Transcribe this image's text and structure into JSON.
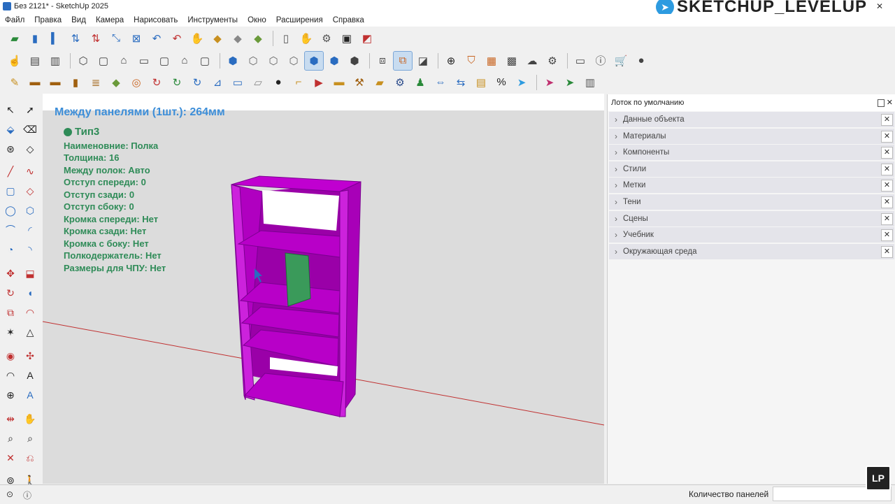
{
  "window": {
    "title": "Без 2121* - SketchUp 2025",
    "brand": "SKETCHUP_LEVELUP",
    "minimize": "▫",
    "close": "✕"
  },
  "menu": [
    "Файл",
    "Правка",
    "Вид",
    "Камера",
    "Нарисовать",
    "Инструменты",
    "Окно",
    "Расширения",
    "Справка"
  ],
  "viewport": {
    "heading": "Между панелями (1шт.): 264мм",
    "type": "Тип3",
    "props": [
      "Наименовние: Полка",
      "Толщина: 16",
      "Между полок: Авто",
      "Отступ спереди: 0",
      "Отступ сзади: 0",
      "Отступ сбоку: 0",
      "Кромка спереди: Нет",
      "Кромка сзади: Нет",
      "Кромка с боку: Нет",
      "Полкодержатель: Нет",
      "Размеры для ЧПУ: Нет"
    ]
  },
  "tray": {
    "title": "Лоток по умолчанию",
    "close": "✕",
    "items": [
      "Данные объекта",
      "Материалы",
      "Компоненты",
      "Стили",
      "Метки",
      "Тени",
      "Сцены",
      "Учебник",
      "Окружающая среда"
    ]
  },
  "status": {
    "label": "Количество панелей",
    "value": ""
  },
  "badge": "LP",
  "colors": {
    "cabinet": "#b000c0",
    "shelf_selected": "#3a9a5a",
    "heading": "#3d8ed8",
    "info": "#2e8b57"
  }
}
